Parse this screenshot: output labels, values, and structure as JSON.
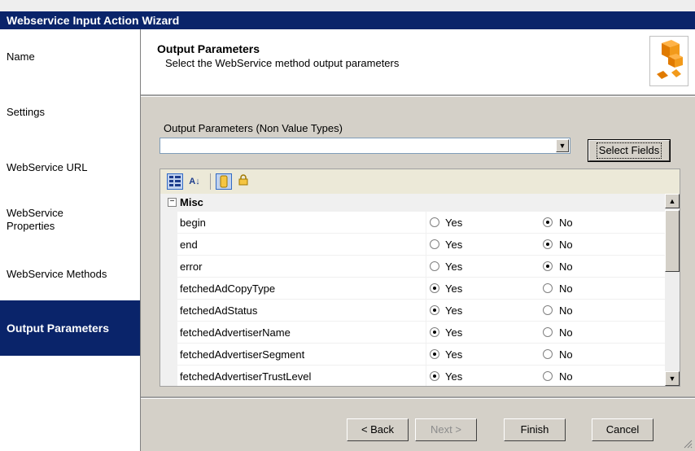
{
  "window": {
    "title": "Webservice Input Action Wizard"
  },
  "sidebar": {
    "items": [
      {
        "label": "Name"
      },
      {
        "label": "Settings"
      },
      {
        "label": "WebService URL"
      },
      {
        "label": "WebService Properties"
      },
      {
        "label": "WebService Methods"
      },
      {
        "label": "Output Parameters",
        "active": true
      }
    ]
  },
  "header": {
    "title": "Output Parameters",
    "subtitle": "Select the WebService method output parameters",
    "icon": "package-cubes-icon"
  },
  "output_params": {
    "label": "Output Parameters (Non Value Types)",
    "value": "",
    "select_fields_label": "Select Fields"
  },
  "grid": {
    "toolbar": [
      "categorized-icon",
      "alphabetical-sort-icon",
      "properties-icon",
      "lock-icon"
    ],
    "category": "Misc",
    "yes_label": "Yes",
    "no_label": "No",
    "rows": [
      {
        "name": "begin",
        "value": "No"
      },
      {
        "name": "end",
        "value": "No"
      },
      {
        "name": "error",
        "value": "No"
      },
      {
        "name": "fetchedAdCopyType",
        "value": "Yes"
      },
      {
        "name": "fetchedAdStatus",
        "value": "Yes"
      },
      {
        "name": "fetchedAdvertiserName",
        "value": "Yes"
      },
      {
        "name": "fetchedAdvertiserSegment",
        "value": "Yes"
      },
      {
        "name": "fetchedAdvertiserTrustLevel",
        "value": "Yes"
      }
    ]
  },
  "buttons": {
    "back": "< Back",
    "next": "Next >",
    "finish": "Finish",
    "cancel": "Cancel"
  },
  "colors": {
    "titlebar": "#0a246a",
    "active_nav": "#0a246a",
    "panel": "#d4d0c8"
  }
}
